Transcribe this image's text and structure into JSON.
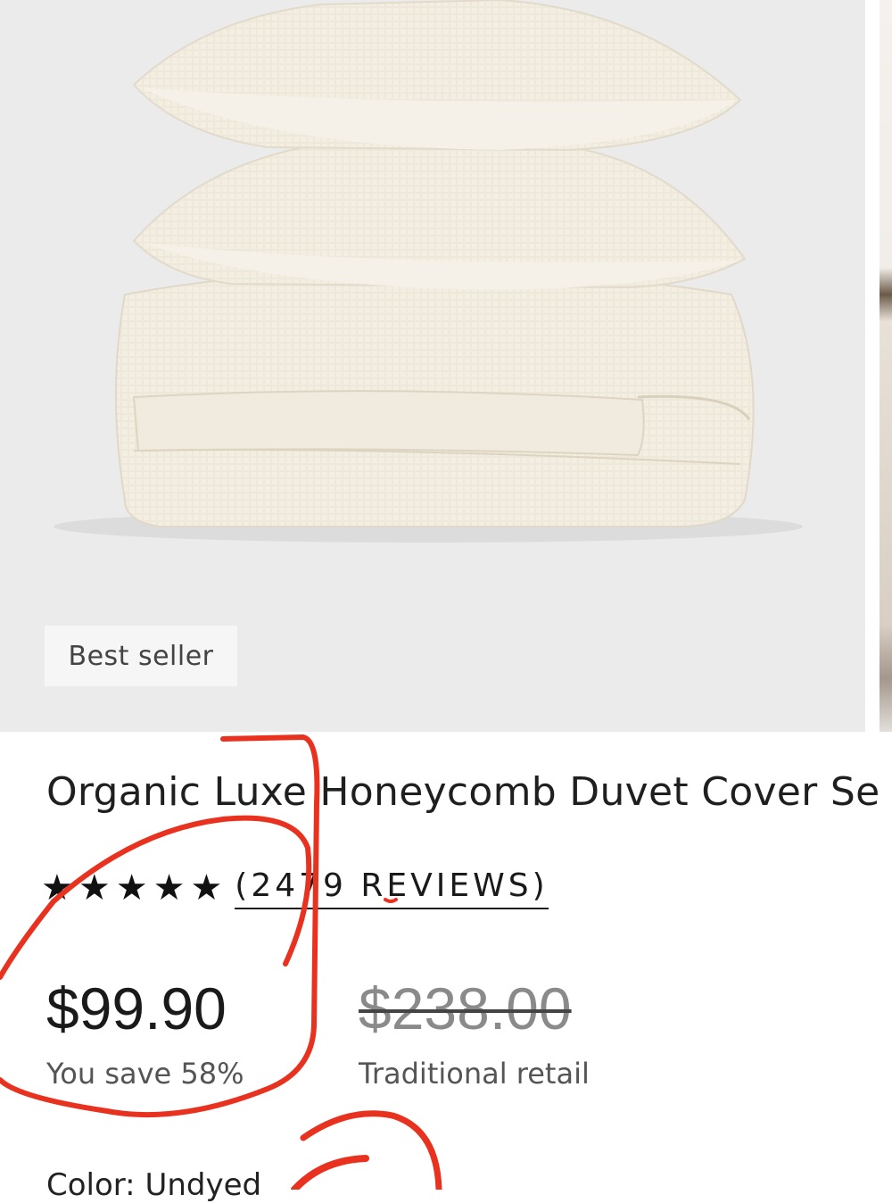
{
  "product": {
    "badge": "Best seller",
    "title": "Organic Luxe Honeycomb Duvet Cover Se",
    "rating_stars": 5,
    "reviews_label": "(2479 REVIEWS)",
    "price": "$99.90",
    "savings": "You save 58%",
    "retail_price": "$238.00",
    "retail_label": "Traditional retail",
    "color_label": "Color:",
    "color_value": "Undyed"
  },
  "icons": {
    "star": "star-icon"
  },
  "colors": {
    "image_background": "#ebebec",
    "annotation_red": "#e8321f",
    "text": "#1d1d1d"
  }
}
